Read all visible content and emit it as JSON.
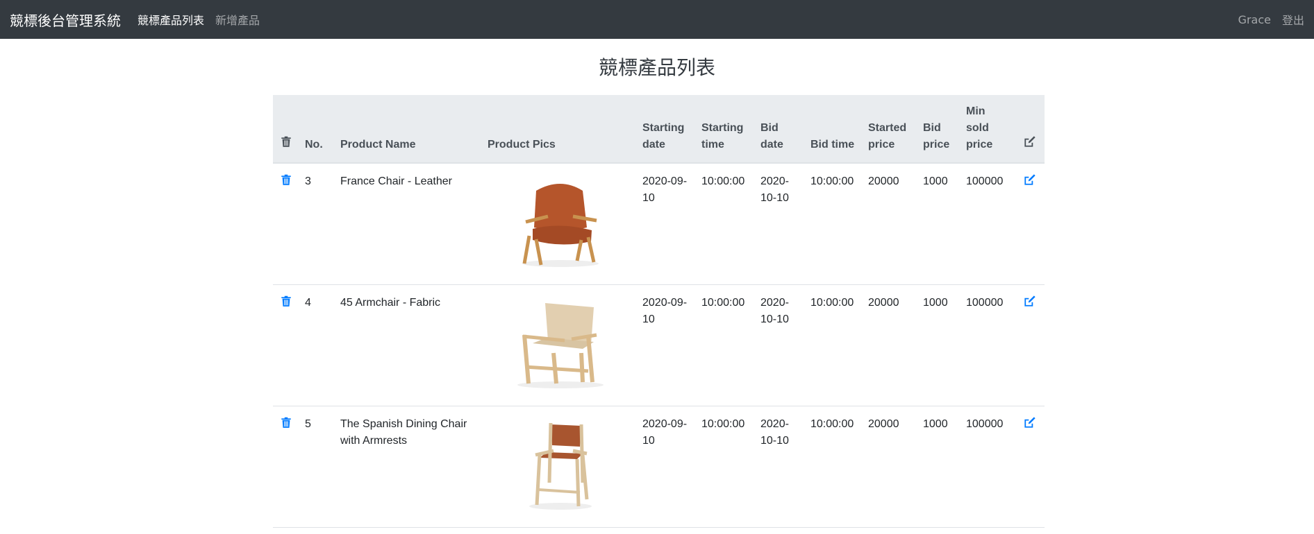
{
  "navbar": {
    "brand": "競標後台管理系統",
    "links": [
      {
        "label": "競標產品列表",
        "active": true
      },
      {
        "label": "新增產品",
        "active": false
      }
    ],
    "user": "Grace",
    "logout": "登出"
  },
  "page": {
    "title": "競標產品列表"
  },
  "table": {
    "headers": {
      "delete_icon": "trash-icon",
      "no": "No.",
      "name": "Product Name",
      "pics": "Product Pics",
      "start_date": "Starting date",
      "start_time": "Starting time",
      "bid_date": "Bid date",
      "bid_time": "Bid time",
      "started_price": "Started price",
      "bid_price": "Bid price",
      "min_sold_price": "Min sold price",
      "edit_icon": "edit-icon"
    },
    "rows": [
      {
        "no": "3",
        "name": "France Chair - Leather",
        "pic": "leather-lounge-chair-image",
        "start_date": "2020-09-10",
        "start_time": "10:00:00",
        "bid_date": "2020-10-10",
        "bid_time": "10:00:00",
        "started_price": "20000",
        "bid_price": "1000",
        "min_sold_price": "100000"
      },
      {
        "no": "4",
        "name": "45 Armchair - Fabric",
        "pic": "fabric-armchair-image",
        "start_date": "2020-09-10",
        "start_time": "10:00:00",
        "bid_date": "2020-10-10",
        "bid_time": "10:00:00",
        "started_price": "20000",
        "bid_price": "1000",
        "min_sold_price": "100000"
      },
      {
        "no": "5",
        "name": "The Spanish Dining Chair with Armrests",
        "pic": "spanish-dining-chair-image",
        "start_date": "2020-09-10",
        "start_time": "10:00:00",
        "bid_date": "2020-10-10",
        "bid_time": "10:00:00",
        "started_price": "20000",
        "bid_price": "1000",
        "min_sold_price": "100000"
      }
    ]
  },
  "colors": {
    "navbar_bg": "#343a40",
    "header_bg": "#e9ecef",
    "icon_blue": "#007bff",
    "icon_dark": "#495057"
  }
}
